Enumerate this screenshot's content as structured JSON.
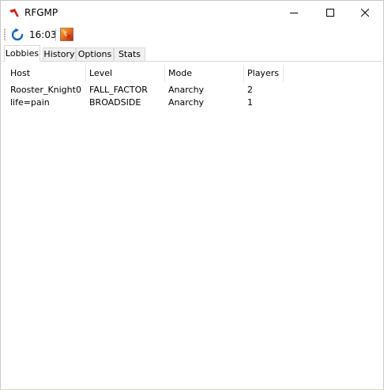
{
  "window": {
    "title": "RFGMP"
  },
  "toolbar": {
    "time": "16:03"
  },
  "tabs": [
    {
      "label": "Lobbies",
      "active": true
    },
    {
      "label": "History",
      "active": false
    },
    {
      "label": "Options",
      "active": false
    },
    {
      "label": "Stats",
      "active": false
    }
  ],
  "lobbies": {
    "columns": [
      "Host",
      "Level",
      "Mode",
      "Players"
    ],
    "rows": [
      {
        "host": "Rooster_Knight0",
        "level": "FALL_FACTOR",
        "mode": "Anarchy",
        "players": "2"
      },
      {
        "host": "life=pain",
        "level": "BROADSIDE",
        "mode": "Anarchy",
        "players": "1"
      }
    ]
  },
  "icons": {
    "app": "red-faction-logo-icon",
    "refresh": "refresh-icon",
    "game": "game-launch-icon"
  },
  "colors": {
    "refresh_blue": "#1565c0",
    "app_red": "#d32222"
  }
}
